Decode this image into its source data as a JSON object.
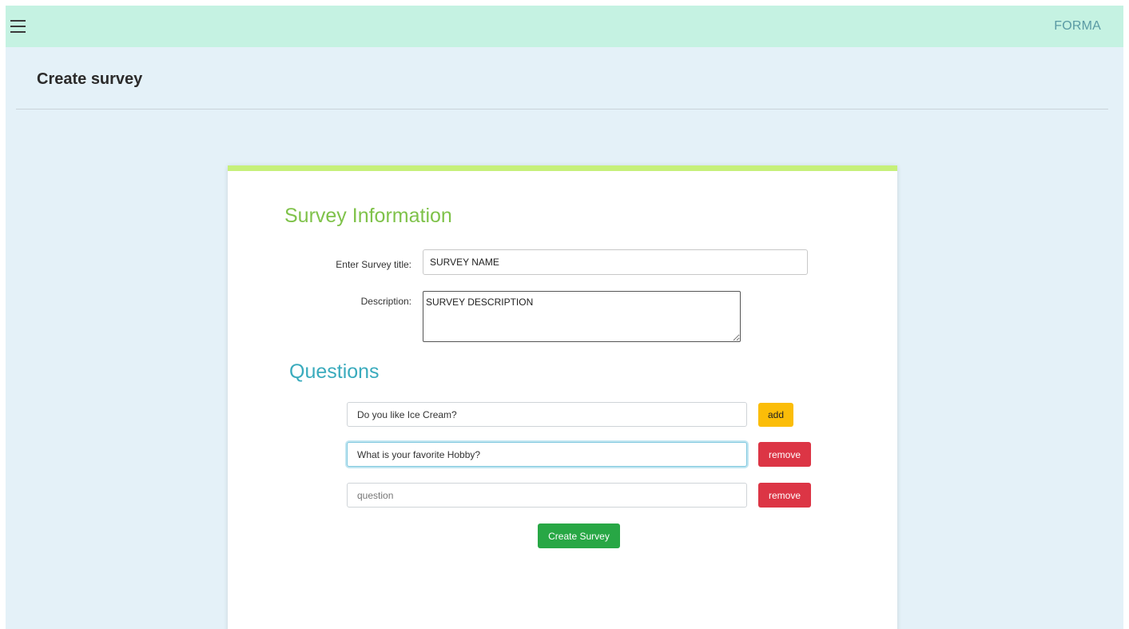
{
  "navbar": {
    "menu_icon": "hamburger-menu-icon",
    "brand": "FORMA"
  },
  "page": {
    "title": "Create survey"
  },
  "survey_info": {
    "heading": "Survey Information",
    "title_label": "Enter Survey title:",
    "title_value": "SURVEY NAME",
    "description_label": "Description:",
    "description_value": "SURVEY DESCRIPTION"
  },
  "questions": {
    "heading": "Questions",
    "items": [
      {
        "value": "Do you like Ice Cream?",
        "placeholder": "question",
        "action": "add"
      },
      {
        "value": "What is your favorite Hobby?",
        "placeholder": "question",
        "action": "remove"
      },
      {
        "value": "",
        "placeholder": "question",
        "action": "remove"
      }
    ],
    "create_label": "Create Survey"
  },
  "colors": {
    "navbar_bg": "#c5f2e2",
    "page_bg": "#e4f1f8",
    "card_accent": "#c6f07a",
    "info_heading": "#7fc24a",
    "questions_heading": "#3aabbd",
    "add_button": "#fbbd08",
    "remove_button": "#dc3545",
    "create_button": "#28a745"
  }
}
